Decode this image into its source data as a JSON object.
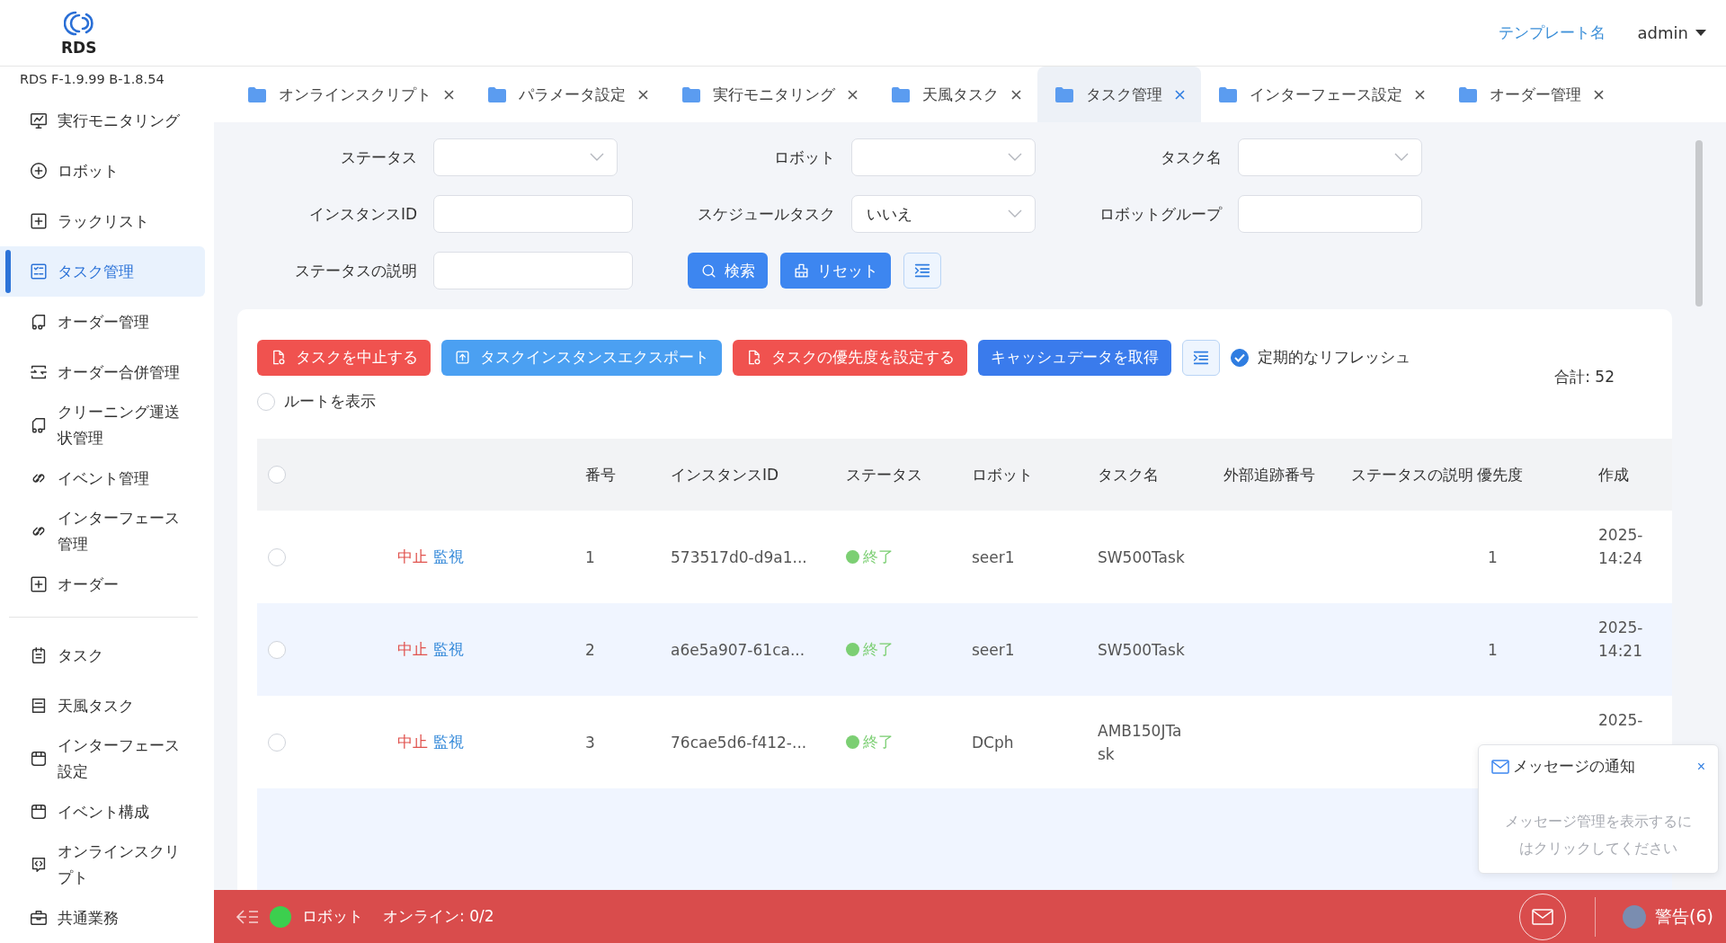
{
  "header": {
    "logo_text": "RDS",
    "template_link": "テンプレート名",
    "user": "admin",
    "version": "RDS F-1.9.99 B-1.8.54"
  },
  "sidebar": {
    "groups": [
      {
        "items": [
          {
            "label": "実行モニタリング",
            "kind": "monitor",
            "selected": false
          },
          {
            "label": "ロボット",
            "kind": "plus-circle",
            "selected": false
          },
          {
            "label": "ラックリスト",
            "kind": "plus-square",
            "selected": false
          },
          {
            "label": "タスク管理",
            "kind": "checklist",
            "selected": true
          },
          {
            "label": "オーダー管理",
            "kind": "truck",
            "selected": false
          },
          {
            "label": "オーダー合併管理",
            "kind": "merge",
            "selected": false
          },
          {
            "label": "クリーニング運送状管理",
            "kind": "truck",
            "selected": false
          },
          {
            "label": "イベント管理",
            "kind": "link",
            "selected": false
          },
          {
            "label": "インターフェース管理",
            "kind": "link",
            "selected": false
          },
          {
            "label": "オーダー",
            "kind": "plus-square",
            "selected": false
          }
        ]
      },
      {
        "items": [
          {
            "label": "タスク",
            "kind": "clipboard",
            "selected": false
          },
          {
            "label": "天風タスク",
            "kind": "tray",
            "selected": false
          },
          {
            "label": "インターフェース設定",
            "kind": "window",
            "selected": false
          },
          {
            "label": "イベント構成",
            "kind": "window",
            "selected": false
          },
          {
            "label": "オンラインスクリプト",
            "kind": "code",
            "selected": false
          },
          {
            "label": "共通業務",
            "kind": "briefcase",
            "selected": false
          }
        ]
      }
    ]
  },
  "tabs": [
    {
      "label": "オンラインスクリプト",
      "selected": false
    },
    {
      "label": "パラメータ設定",
      "selected": false
    },
    {
      "label": "実行モニタリング",
      "selected": false
    },
    {
      "label": "天風タスク",
      "selected": false
    },
    {
      "label": "タスク管理",
      "selected": true
    },
    {
      "label": "インターフェース設定",
      "selected": false
    },
    {
      "label": "オーダー管理",
      "selected": false
    }
  ],
  "filters": [
    {
      "label": "ステータス",
      "kind": "select"
    },
    {
      "label": "ロボット",
      "kind": "select"
    },
    {
      "label": "タスク名",
      "kind": "select"
    },
    {
      "label": "インスタンスID",
      "kind": "input"
    },
    {
      "label": "スケジュールタスク",
      "kind": "select",
      "value": "いいえ"
    },
    {
      "label": "ロボットグループ",
      "kind": "input"
    },
    {
      "label": "ステータスの説明",
      "kind": "input"
    }
  ],
  "filter_buttons": [
    {
      "label": "検索",
      "kind": "search"
    },
    {
      "label": "リセット",
      "kind": "reset"
    }
  ],
  "toolbar": {
    "buttons": [
      {
        "label": "タスクを中止する",
        "kind": "danger"
      },
      {
        "label": "タスクインスタンスエクスポート",
        "kind": "export"
      },
      {
        "label": "タスクの優先度を設定する",
        "kind": "danger"
      },
      {
        "label": "キャッシュデータを取得",
        "kind": "primary"
      }
    ],
    "auto_refresh": {
      "label": "定期的なリフレッシュ",
      "checked": true
    },
    "total": "合計: 52",
    "show_route": {
      "label": "ルートを表示",
      "checked": false
    }
  },
  "table": {
    "select_all": {
      "checked": false
    },
    "columns": [
      "番号",
      "インスタンスID",
      "ステータス",
      "ロボット",
      "タスク名",
      "外部追跡番号",
      "ステータスの説明",
      "優先度",
      "作成"
    ],
    "rows": [
      {
        "checked": false,
        "selected": false,
        "actions": [
          "中止",
          "監視"
        ],
        "number": "1",
        "instance_id": "573517d0-d9a1...",
        "status": "終了",
        "color": "#7ccf73",
        "robot": "seer1",
        "task_name": "SW500Task",
        "priority": "1",
        "created": [
          "2025-",
          "14:24"
        ]
      },
      {
        "checked": false,
        "selected": true,
        "actions": [
          "中止",
          "監視"
        ],
        "number": "2",
        "instance_id": "a6e5a907-61ca...",
        "status": "終了",
        "color": "#7ccf73",
        "robot": "seer1",
        "task_name": "SW500Task",
        "priority": "1",
        "created": [
          "2025-",
          "14:21"
        ]
      },
      {
        "checked": false,
        "selected": false,
        "actions": [
          "中止",
          "監視"
        ],
        "number": "3",
        "instance_id": "76cae5d6-f412-...",
        "status": "終了",
        "color": "#7ccf73",
        "robot": "DCph",
        "task_name": "AMB150JTask",
        "created": [
          "2025-"
        ]
      }
    ]
  },
  "notification": {
    "title": "メッセージの通知",
    "close": "×",
    "body": "メッセージ管理を表示するにはクリックしてください"
  },
  "status_bar": {
    "robot_label": "ロボット",
    "online": "オンライン: 0/2",
    "warnings": "警告(6)"
  }
}
